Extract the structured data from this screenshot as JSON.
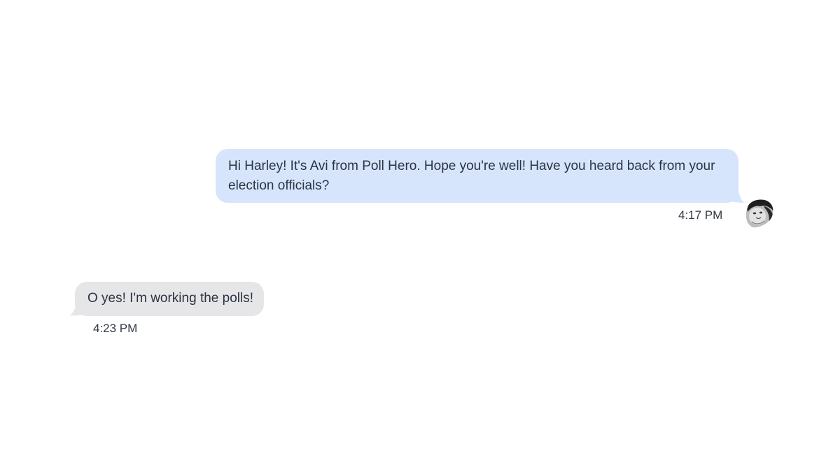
{
  "conversation": {
    "messages": [
      {
        "direction": "outgoing",
        "text": "Hi Harley! It's Avi from Poll Hero. Hope you're well! Have you heard back from your election officials?",
        "time": "4:17 PM",
        "avatar": "sender-avatar"
      },
      {
        "direction": "incoming",
        "text": "O yes! I'm working the polls!",
        "time": "4:23 PM"
      }
    ]
  },
  "colors": {
    "outgoing_bubble": "#d6e5fc",
    "incoming_bubble": "#e6e6e8",
    "text": "#2b3442",
    "background": "#ffffff"
  }
}
